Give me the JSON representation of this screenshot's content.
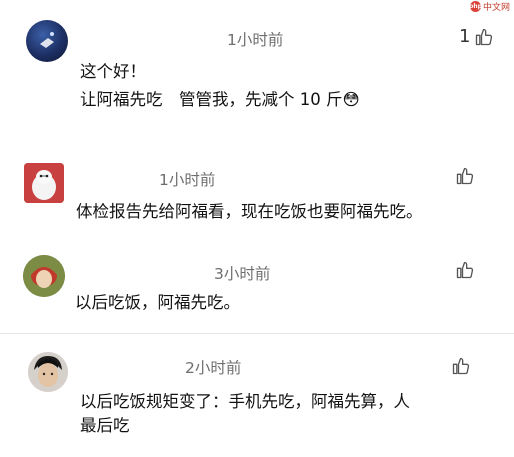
{
  "watermark": {
    "badge": "php",
    "text": "中文网"
  },
  "comments": [
    {
      "time": "1小时前",
      "likes": "1",
      "lines": [
        "这个好！",
        "让阿福先吃　管管我，先减个 10 斤😳"
      ]
    },
    {
      "time": "1小时前",
      "likes": "",
      "lines": [
        "体检报告先给阿福看，现在吃饭也要阿福先吃。"
      ]
    },
    {
      "time": "3小时前",
      "likes": "",
      "lines": [
        "以后吃饭，阿福先吃。"
      ]
    },
    {
      "time": "2小时前",
      "likes": "",
      "lines": [
        "以后吃饭规矩变了：手机先吃，阿福先算，人",
        "最后吃"
      ]
    }
  ],
  "icons": {
    "like": "thumbs-up-icon"
  }
}
